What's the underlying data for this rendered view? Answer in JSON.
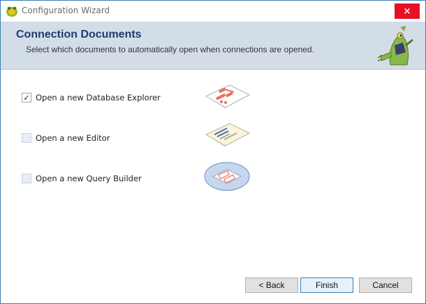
{
  "window": {
    "title": "Configuration Wizard",
    "close_glyph": "×"
  },
  "header": {
    "title": "Connection Documents",
    "subtitle": "Select which documents to automatically open when connections are opened."
  },
  "options": [
    {
      "label": "Open a new Database Explorer",
      "checked": true,
      "check_glyph": "✓",
      "icon": "database-explorer-icon"
    },
    {
      "label": "Open a new Editor",
      "checked": false,
      "check_glyph": "",
      "icon": "editor-icon"
    },
    {
      "label": "Open a new Query Builder",
      "checked": false,
      "check_glyph": "",
      "icon": "query-builder-icon"
    }
  ],
  "buttons": {
    "back": "< Back",
    "finish": "Finish",
    "cancel": "Cancel"
  },
  "colors": {
    "header_band": "#d3dde8",
    "header_title": "#1d3c6e",
    "close_button": "#e81123",
    "window_border": "#3c7fb1"
  }
}
